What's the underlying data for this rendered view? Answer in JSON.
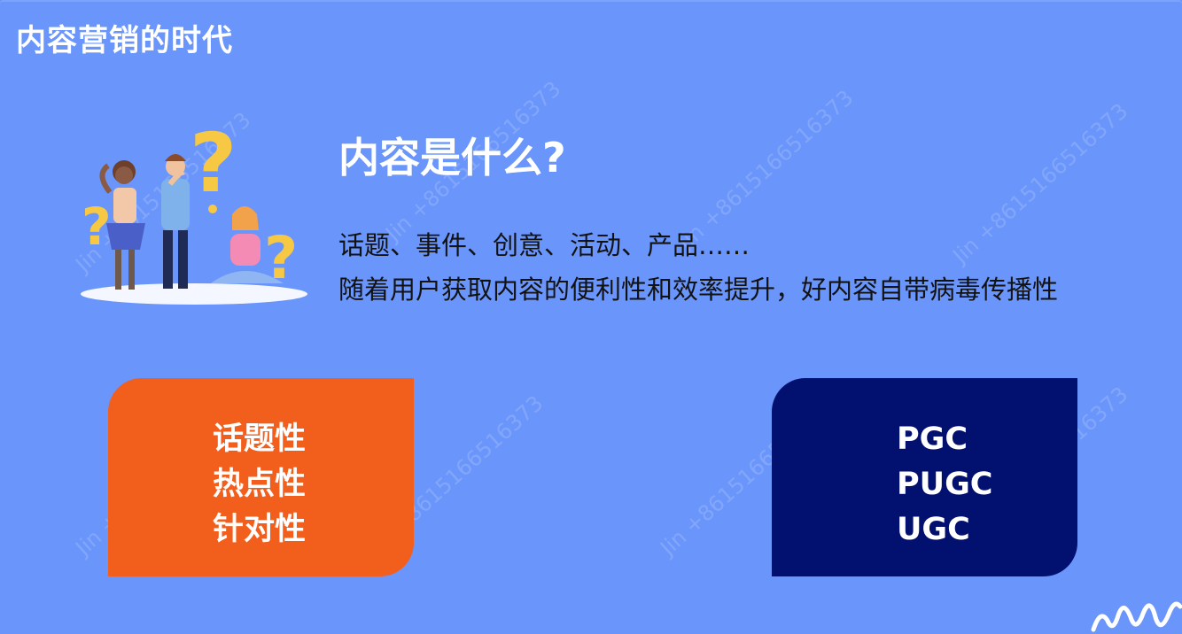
{
  "slide": {
    "title": "内容营销的时代",
    "heading": "内容是什么?",
    "body_lines": [
      "话题、事件、创意、活动、产品……",
      "随着用户获取内容的便利性和效率提升，好内容自带病毒传播性"
    ]
  },
  "cards": [
    {
      "color": "#f25e1c",
      "items": [
        "话题性",
        "热点性",
        "针对性"
      ]
    },
    {
      "color": "#021170",
      "items": [
        "PGC",
        "PUGC",
        "UGC"
      ]
    }
  ],
  "watermark": {
    "text": "Jin +8615166516373"
  },
  "illustration": {
    "name": "people-with-question-marks"
  },
  "colors": {
    "background": "#6a96fb",
    "text_dark": "#121212",
    "white": "#ffffff"
  }
}
